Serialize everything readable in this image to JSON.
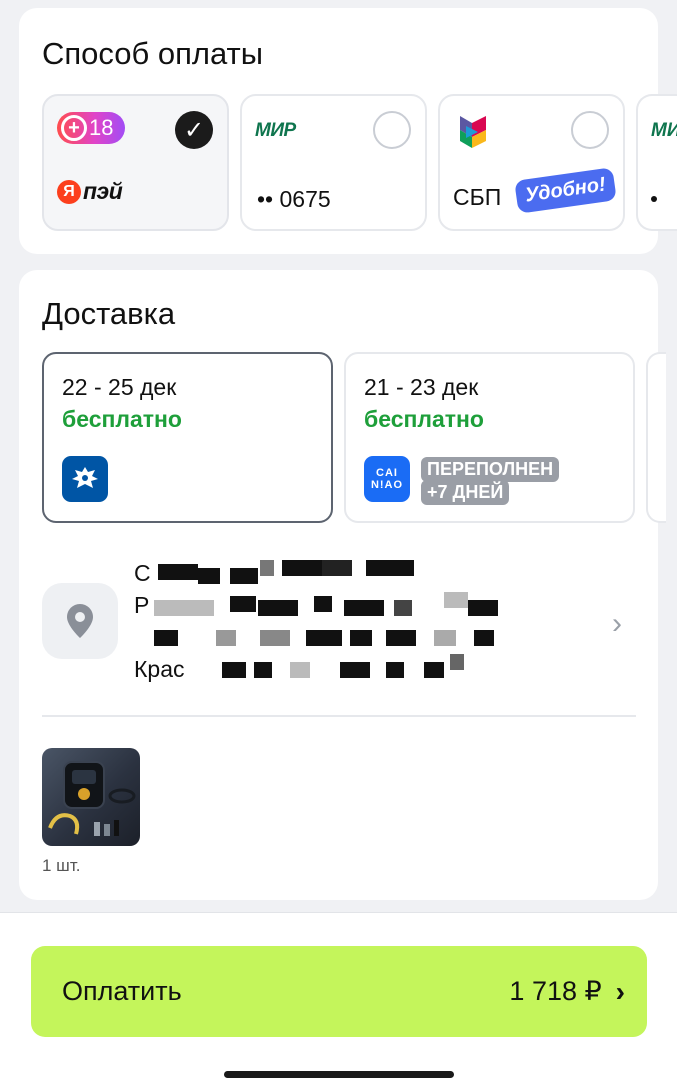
{
  "payment": {
    "title": "Способ оплаты",
    "methods": [
      {
        "badge": "18",
        "brand": "пэй",
        "brand_mark": "Я",
        "selected": true
      },
      {
        "network": "МИР",
        "masked_number": "•• 0675",
        "selected": false
      },
      {
        "name": "СБП",
        "tag": "Удобно!",
        "selected": false
      },
      {
        "network": "МИР",
        "selected": false
      }
    ]
  },
  "delivery": {
    "title": "Доставка",
    "options": [
      {
        "dates": "22 - 25 дек",
        "price": "бесплатно",
        "carrier_icon": "russian-post-eagle-icon",
        "selected": true
      },
      {
        "dates": "21 - 23 дек",
        "price": "бесплатно",
        "carrier_icon": "cainiao-icon",
        "carrier_text": "CAI\nN!AO",
        "badge_line1": "ПЕРЕПОЛНЕН",
        "badge_line2": "+7 ДНЕЙ",
        "selected": false
      }
    ],
    "address": {
      "line1": "С",
      "line2": "Р",
      "line3": "",
      "line4": "Крас"
    },
    "product": {
      "quantity": "1 шт."
    }
  },
  "checkout": {
    "button_label": "Оплатить",
    "total": "1 718 ₽"
  },
  "colors": {
    "accent_green_button": "#c4f55b",
    "free_green": "#1e9f3a",
    "sbp_tag": "#4b6cf0",
    "mir_green": "#0f754e"
  }
}
